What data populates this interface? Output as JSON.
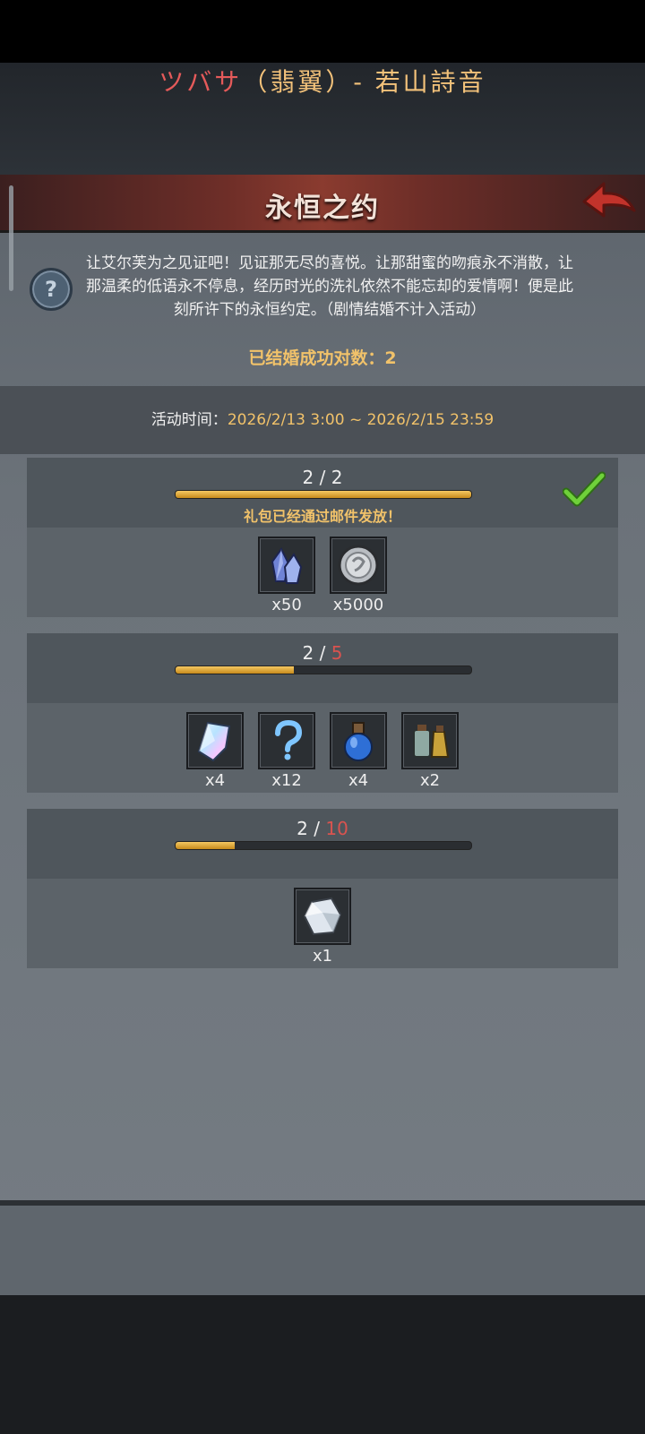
{
  "song": {
    "title_red": "ツバサ",
    "title_rest": "（翡翼）- 若山詩音"
  },
  "header": {
    "title": "永恒之约"
  },
  "description": "让艾尔芙为之见证吧！见证那无尽的喜悦。让那甜蜜的吻痕永不消散，让那温柔的低语永不停息，经历时光的洗礼依然不能忘却的爱情啊！便是此刻所许下的永恒约定。（剧情结婚不计入活动）",
  "count": {
    "label": "已结婚成功对数：",
    "value": "2"
  },
  "event_time": {
    "label": "活动时间：",
    "value": "2026/2/13 3:00 ~ 2026/2/15 23:59"
  },
  "tiers": [
    {
      "current": "2",
      "sep": " / ",
      "goal": "2",
      "progress": 1.0,
      "completed": true,
      "message": "礼包已经通过邮件发放！",
      "rewards": [
        {
          "icon": "blue-crystal-icon",
          "qty": "x50"
        },
        {
          "icon": "silver-coin-icon",
          "qty": "x5000"
        }
      ]
    },
    {
      "current": "2",
      "sep": " / ",
      "goal": "5",
      "progress": 0.4,
      "completed": false,
      "rewards": [
        {
          "icon": "rainbow-crystal-icon",
          "qty": "x4"
        },
        {
          "icon": "mystery-question-icon",
          "qty": "x12"
        },
        {
          "icon": "blue-potion-icon",
          "qty": "x4"
        },
        {
          "icon": "potion-bottles-icon",
          "qty": "x2"
        }
      ]
    },
    {
      "current": "2",
      "sep": " / ",
      "goal": "10",
      "progress": 0.2,
      "completed": false,
      "rewards": [
        {
          "icon": "white-ore-icon",
          "qty": "x1"
        }
      ]
    }
  ],
  "colors": {
    "accent_gold": "#f1c26a",
    "goal_red": "#d9534f",
    "header_red": "#8a3b2f",
    "check_green": "#5cc22f"
  }
}
